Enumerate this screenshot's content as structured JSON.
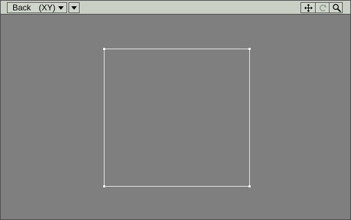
{
  "toolbar": {
    "view_name": "Back",
    "view_axes": "(XY)",
    "icons": {
      "move": "move-icon",
      "rotate": "rotate-icon",
      "zoom": "magnifier-icon"
    }
  },
  "colors": {
    "viewport_bg": "#7f7f7f",
    "toolbar_bg": "#c9cfc5",
    "object_lines": "#e8e8e8"
  }
}
